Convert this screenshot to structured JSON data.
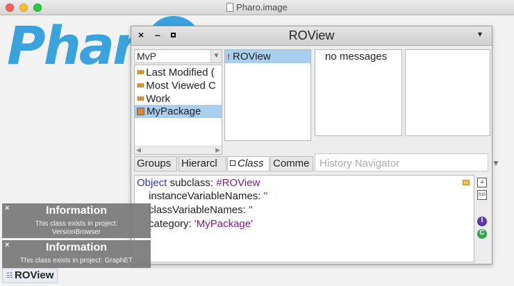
{
  "mac": {
    "title": "Pharo.image"
  },
  "logo": {
    "text": "Phar"
  },
  "window": {
    "title": "ROView",
    "close": "×",
    "minimize": "–",
    "menu": "▾"
  },
  "packages": {
    "filter": "MvP",
    "items": [
      {
        "label": "Last Modified (",
        "icon": "package-group-icon"
      },
      {
        "label": "Most Viewed C",
        "icon": "package-group-icon"
      },
      {
        "label": "Work",
        "icon": "package-group-icon"
      },
      {
        "label": "MyPackage",
        "icon": "package-icon",
        "selected": true
      }
    ]
  },
  "classes": {
    "items": [
      {
        "label": "ROView",
        "selected": true
      }
    ]
  },
  "protocols": {
    "text": "no messages"
  },
  "tabs": [
    "Groups",
    "Hierarcl",
    "Class",
    "Comme"
  ],
  "history": {
    "placeholder": "History Navigator"
  },
  "code": {
    "l1_kw": "Object",
    "l1_text": " subclass: ",
    "l1_sym": "#ROView",
    "l2_text": "instanceVariableNames: ",
    "l2_str": "''",
    "l3_text": "classVariableNames: ",
    "l3_str": "''",
    "l4_text": "category: ",
    "l4_str": "'MyPackage'"
  },
  "notifications": [
    {
      "close": "×",
      "title": "Information",
      "body_1": "This class exists in project:",
      "body_2": "VersionBrowser"
    },
    {
      "close": "×",
      "title": "Information",
      "body_1": "This class exists in project: GraphET",
      "body_2": ""
    }
  ],
  "taskbar": {
    "label": "ROView"
  },
  "colors": {
    "accent": "#3aa3dd",
    "selection": "#a8cef0"
  }
}
